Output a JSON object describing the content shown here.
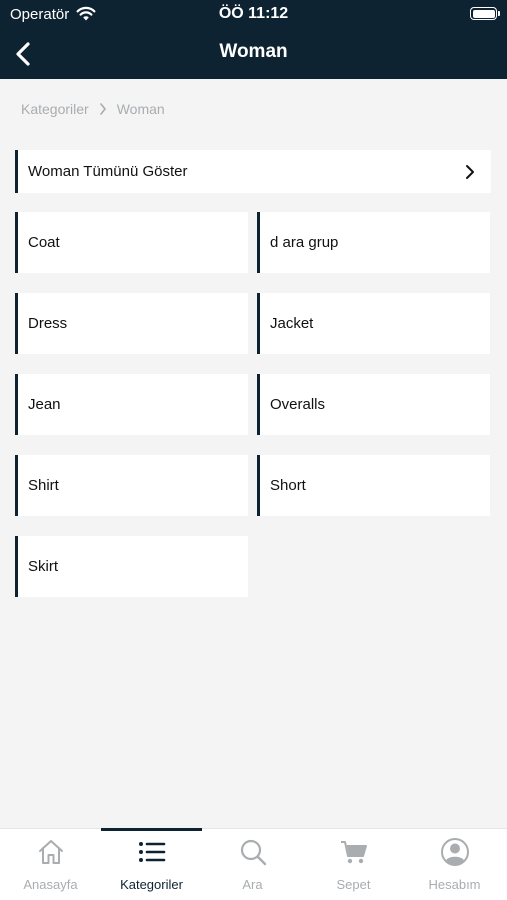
{
  "status": {
    "carrier": "Operatör",
    "time": "ÖÖ 11:12"
  },
  "header": {
    "title": "Woman"
  },
  "breadcrumb": {
    "root": "Kategoriler",
    "current": "Woman"
  },
  "show_all": {
    "label": "Woman Tümünü Göster"
  },
  "categories": [
    {
      "label": "Coat"
    },
    {
      "label": "d ara grup"
    },
    {
      "label": "Dress"
    },
    {
      "label": "Jacket"
    },
    {
      "label": "Jean"
    },
    {
      "label": "Overalls"
    },
    {
      "label": "Shirt"
    },
    {
      "label": "Short"
    },
    {
      "label": "Skirt"
    }
  ],
  "tabs": [
    {
      "label": "Anasayfa",
      "icon": "home-icon"
    },
    {
      "label": "Kategoriler",
      "icon": "list-icon",
      "active": true
    },
    {
      "label": "Ara",
      "icon": "search-icon"
    },
    {
      "label": "Sepet",
      "icon": "cart-icon"
    },
    {
      "label": "Hesabım",
      "icon": "account-icon"
    }
  ],
  "colors": {
    "primary": "#0e2332",
    "background": "#f4f4f4",
    "muted": "#a9adb0"
  }
}
